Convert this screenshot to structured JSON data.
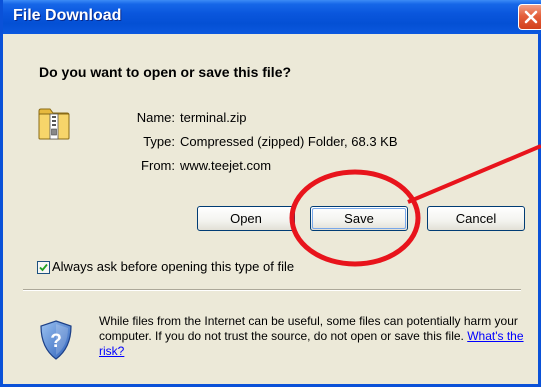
{
  "dialog": {
    "title": "File Download",
    "question": "Do you want to open or save this file?",
    "file_icon": "zip-folder-icon",
    "name_label": "Name:",
    "name_value": "terminal.zip",
    "type_label": "Type:",
    "type_value": "Compressed (zipped) Folder, 68.3 KB",
    "from_label": "From:",
    "from_value": "www.teejet.com",
    "buttons": {
      "open": "Open",
      "save": "Save",
      "cancel": "Cancel"
    },
    "checkbox": {
      "label": "Always ask before opening this type of file",
      "checked": true
    },
    "warning_text": "While files from the Internet can be useful, some files can potentially harm your computer. If you do not trust the source, do not open or save this file. ",
    "warning_link": "What's the risk?",
    "warning_icon": "security-shield-icon"
  },
  "annotation": {
    "type": "red-circle-with-arrow",
    "target": "Save",
    "color": "#e8141c"
  },
  "colors": {
    "titlebar": "#0a56dd",
    "dialog_bg": "#ece9d8",
    "close_button": "#d2401c",
    "link": "#0000ff"
  }
}
